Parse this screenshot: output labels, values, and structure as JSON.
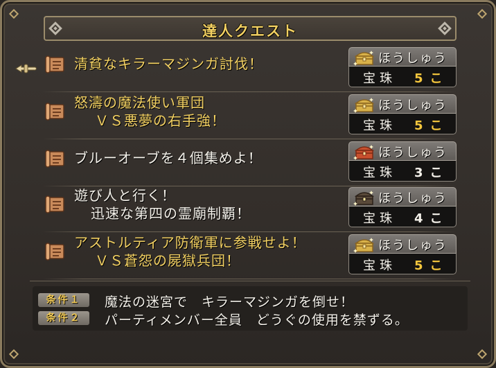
{
  "window": {
    "title": "達人クエスト"
  },
  "colors": {
    "accent_gold": "#f2d062",
    "text_white": "#f4f1ea",
    "count_gold": "#f5c73d"
  },
  "quests": [
    {
      "title_lines": [
        "清貧なキラーマジンガ討伐！"
      ],
      "title_color": "#f2d062",
      "icon": "quest-scroll-icon",
      "reward_label": "ほうしゅう",
      "chest_icon": "gold-chest-icon",
      "reward_item": "宝珠",
      "reward_count": "5こ",
      "count_color": "#f5c73d"
    },
    {
      "title_lines": [
        "怒濤の魔法使い軍団",
        "ＶＳ悪夢の右手強！"
      ],
      "title_color": "#f2d062",
      "icon": "quest-scroll-icon",
      "reward_label": "ほうしゅう",
      "chest_icon": "gold-chest-icon",
      "reward_item": "宝珠",
      "reward_count": "5こ",
      "count_color": "#f5c73d"
    },
    {
      "title_lines": [
        "ブルーオーブを４個集めよ！"
      ],
      "title_color": "#f4f1ea",
      "icon": "quest-scroll-icon",
      "reward_label": "ほうしゅう",
      "chest_icon": "red-chest-icon",
      "reward_item": "宝珠",
      "reward_count": "3こ",
      "count_color": "#f4f1ea"
    },
    {
      "title_lines": [
        "遊び人と行く！",
        "迅速な第四の霊廟制覇！"
      ],
      "title_color": "#f4f1ea",
      "icon": "quest-scroll-icon",
      "reward_label": "ほうしゅう",
      "chest_icon": "dark-chest-icon",
      "reward_item": "宝珠",
      "reward_count": "4こ",
      "count_color": "#f4f1ea"
    },
    {
      "title_lines": [
        "アストルティア防衛軍に参戦せよ！",
        "ＶＳ蒼怨の屍獄兵団！"
      ],
      "title_color": "#f2d062",
      "icon": "quest-scroll-icon",
      "reward_label": "ほうしゅう",
      "chest_icon": "gold-chest-icon",
      "reward_item": "宝珠",
      "reward_count": "5こ",
      "count_color": "#f5c73d"
    }
  ],
  "conditions": [
    {
      "label": "条件１",
      "text": "魔法の迷宮で　キラーマジンガを倒せ！"
    },
    {
      "label": "条件２",
      "text": "パーティメンバー全員　どうぐの使用を禁ずる。"
    }
  ],
  "selection": {
    "selected_index": 0,
    "cursor_icon": "pointing-hand-cursor-icon"
  }
}
